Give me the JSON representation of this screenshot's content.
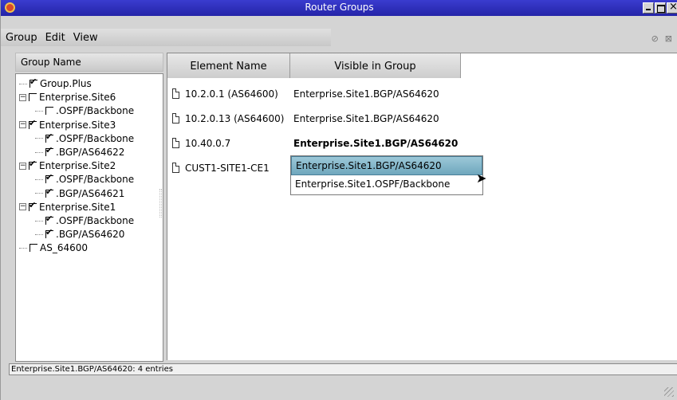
{
  "window": {
    "title": "Router Groups"
  },
  "menu": {
    "items": [
      "Group",
      "Edit",
      "View"
    ]
  },
  "left_pane": {
    "header": "Group Name",
    "tree": [
      {
        "label": "Group.Plus",
        "checked": true,
        "level": 0,
        "expander": null
      },
      {
        "label": "Enterprise.Site6",
        "checked": false,
        "level": 0,
        "expander": "-"
      },
      {
        "label": ".OSPF/Backbone",
        "checked": false,
        "level": 1,
        "expander": null
      },
      {
        "label": "Enterprise.Site3",
        "checked": true,
        "level": 0,
        "expander": "-"
      },
      {
        "label": ".OSPF/Backbone",
        "checked": true,
        "level": 1,
        "expander": null
      },
      {
        "label": ".BGP/AS64622",
        "checked": true,
        "level": 1,
        "expander": null
      },
      {
        "label": "Enterprise.Site2",
        "checked": true,
        "level": 0,
        "expander": "-"
      },
      {
        "label": ".OSPF/Backbone",
        "checked": true,
        "level": 1,
        "expander": null
      },
      {
        "label": ".BGP/AS64621",
        "checked": true,
        "level": 1,
        "expander": null
      },
      {
        "label": "Enterprise.Site1",
        "checked": true,
        "level": 0,
        "expander": "-"
      },
      {
        "label": ".OSPF/Backbone",
        "checked": true,
        "level": 1,
        "expander": null
      },
      {
        "label": ".BGP/AS64620",
        "checked": true,
        "level": 1,
        "expander": null
      },
      {
        "label": "AS_64600",
        "checked": false,
        "level": 0,
        "expander": null
      }
    ]
  },
  "table": {
    "columns": [
      "Element Name",
      "Visible in Group"
    ],
    "rows": [
      {
        "name": "10.2.0.1 (AS64600)",
        "group": "Enterprise.Site1.BGP/AS64620",
        "bold": false
      },
      {
        "name": "10.2.0.13 (AS64600)",
        "group": "Enterprise.Site1.BGP/AS64620",
        "bold": false
      },
      {
        "name": "10.40.0.7",
        "group": "Enterprise.Site1.BGP/AS64620",
        "bold": true
      },
      {
        "name": "CUST1-SITE1-CE1",
        "group": "",
        "bold": false
      }
    ],
    "dropdown": {
      "options": [
        "Enterprise.Site1.BGP/AS64620",
        "Enterprise.Site1.OSPF/Backbone"
      ],
      "selected_index": 0
    }
  },
  "status": {
    "text": "Enterprise.Site1.BGP/AS64620: 4 entries"
  },
  "icons": {
    "app": "router-app-icon",
    "cursor": "mouse-pointer-icon"
  }
}
